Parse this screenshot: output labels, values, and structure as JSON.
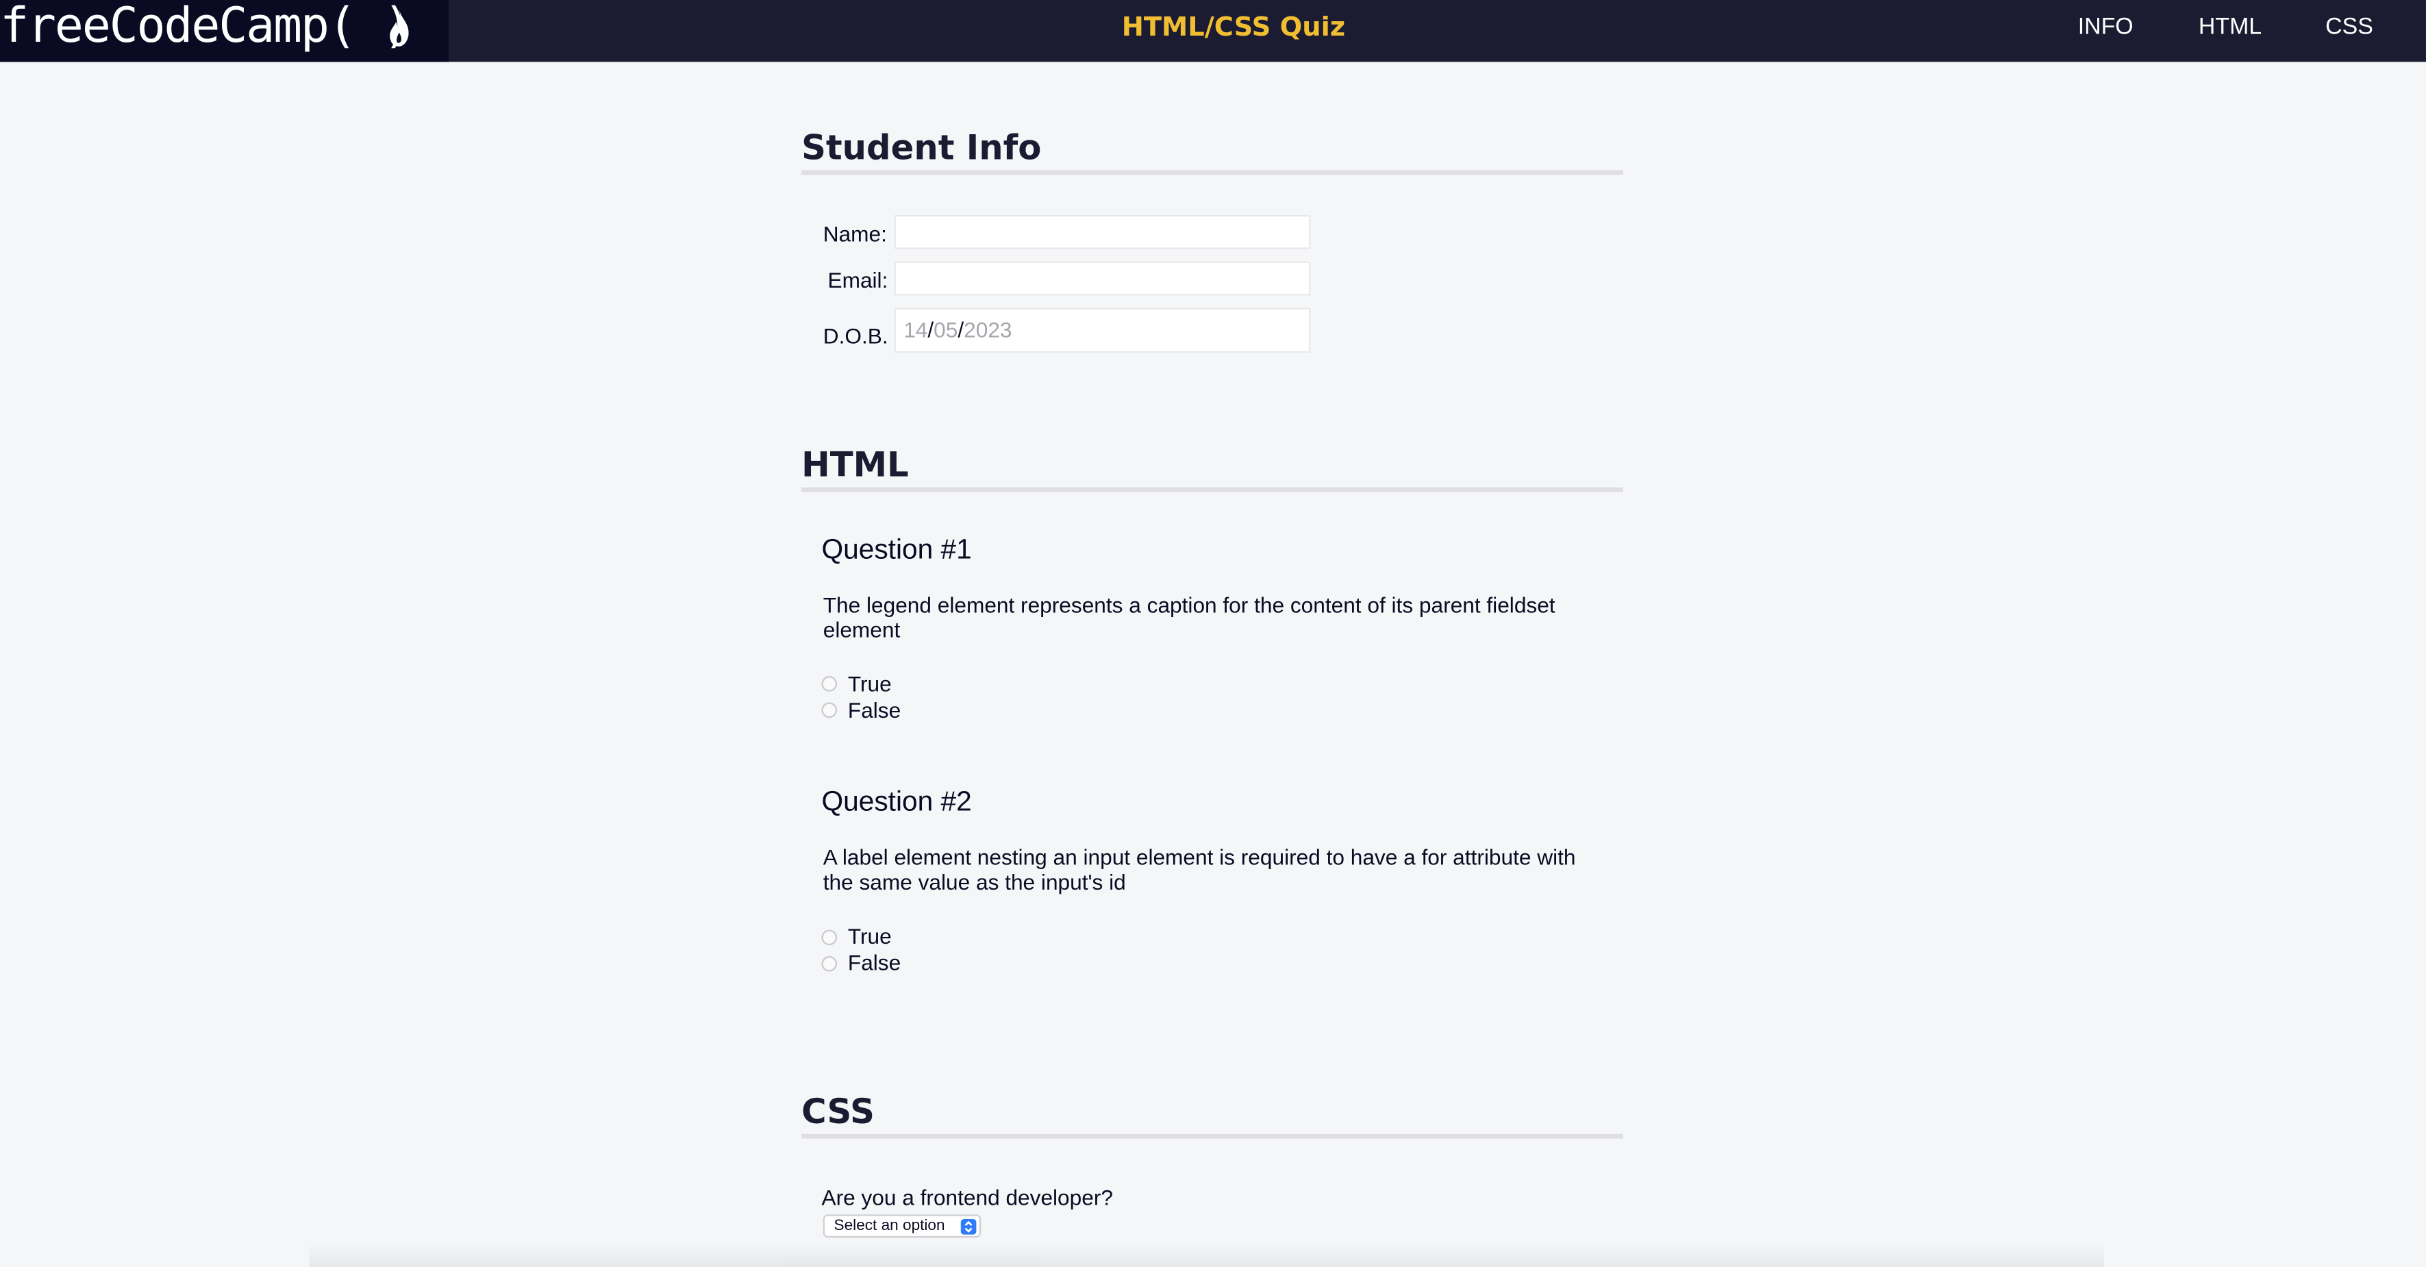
{
  "header": {
    "logo_text": "freeCodeCamp(",
    "logo_close": ")",
    "title": "HTML/CSS Quiz",
    "nav": [
      "INFO",
      "HTML",
      "CSS"
    ]
  },
  "student_info": {
    "title": "Student Info",
    "name_label": "Name:",
    "email_label": "Email:",
    "dob_label": "D.O.B.",
    "dob_day": "14",
    "dob_month": "05",
    "dob_year": "2023",
    "dob_separator": "/"
  },
  "html_section": {
    "title": "HTML",
    "questions": [
      {
        "title": "Question #1",
        "text": "The legend element represents a caption for the content of its parent fieldset element",
        "options": [
          "True",
          "False"
        ]
      },
      {
        "title": "Question #2",
        "text": "A label element nesting an input element is required to have a for attribute with the same value as the input's id",
        "options": [
          "True",
          "False"
        ]
      }
    ]
  },
  "css_section": {
    "title": "CSS",
    "question": "Are you a frontend developer?",
    "select_value": "Select an option"
  },
  "colors": {
    "header_bg": "#1b1b32",
    "logo_bg": "#0a0a23",
    "title_accent": "#f1be32",
    "page_bg": "#f5f6f7",
    "select_accent": "#2e7cf6"
  },
  "icons": {
    "logo": "fire-icon",
    "select": "updown-arrows-icon"
  }
}
